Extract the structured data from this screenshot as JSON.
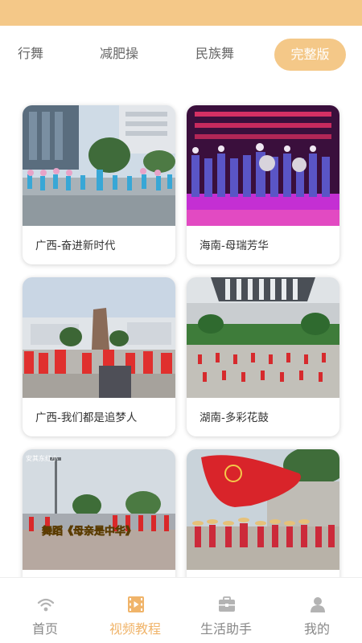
{
  "tabs": [
    {
      "label": "行舞"
    },
    {
      "label": "减肥操"
    },
    {
      "label": "民族舞"
    },
    {
      "label": "完整版",
      "active": true
    }
  ],
  "videos": [
    {
      "title": "广西-奋进新时代"
    },
    {
      "title": "海南-母瑞芳华"
    },
    {
      "title": "广西-我们都是追梦人"
    },
    {
      "title": "湖南-多彩花鼓"
    },
    {
      "overlay_caption": "舞蹈《母亲是中华》",
      "corner_text": "安其东红小"
    },
    {}
  ],
  "bottom_nav": [
    {
      "label": "首页",
      "icon": "wifi-icon"
    },
    {
      "label": "视频教程",
      "icon": "film-icon",
      "active": true
    },
    {
      "label": "生活助手",
      "icon": "briefcase-icon"
    },
    {
      "label": "我的",
      "icon": "user-icon"
    }
  ],
  "colors": {
    "accent": "#f4c888",
    "active_text": "#f0b46a"
  }
}
